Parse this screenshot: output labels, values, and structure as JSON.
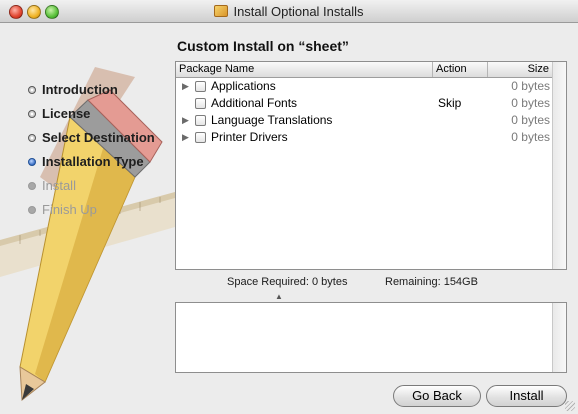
{
  "window": {
    "title": "Install Optional Installs"
  },
  "sidebar": {
    "steps": [
      {
        "label": "Introduction",
        "state": "done"
      },
      {
        "label": "License",
        "state": "done"
      },
      {
        "label": "Select Destination",
        "state": "done"
      },
      {
        "label": "Installation Type",
        "state": "active"
      },
      {
        "label": "Install",
        "state": "pending"
      },
      {
        "label": "Finish Up",
        "state": "pending"
      }
    ]
  },
  "main": {
    "heading": "Custom Install on “sheet”",
    "columns": {
      "name": "Package Name",
      "action": "Action",
      "size": "Size"
    },
    "packages": [
      {
        "name": "Applications",
        "action": "",
        "size": "0 bytes",
        "expandable": true
      },
      {
        "name": "Additional Fonts",
        "action": "Skip",
        "size": "0 bytes",
        "expandable": false
      },
      {
        "name": "Language Translations",
        "action": "",
        "size": "0 bytes",
        "expandable": true
      },
      {
        "name": "Printer Drivers",
        "action": "",
        "size": "0 bytes",
        "expandable": true
      }
    ],
    "space_required_label": "Space Required:  0 bytes",
    "remaining_label": "Remaining:  154GB"
  },
  "buttons": {
    "back": "Go Back",
    "install": "Install"
  },
  "colors": {
    "accent": "#3a6fc5",
    "pencil": "#f2d36b"
  },
  "icons": {
    "title_icon": "installer-box-icon",
    "disclosure": "disclosure-triangle-icon"
  }
}
